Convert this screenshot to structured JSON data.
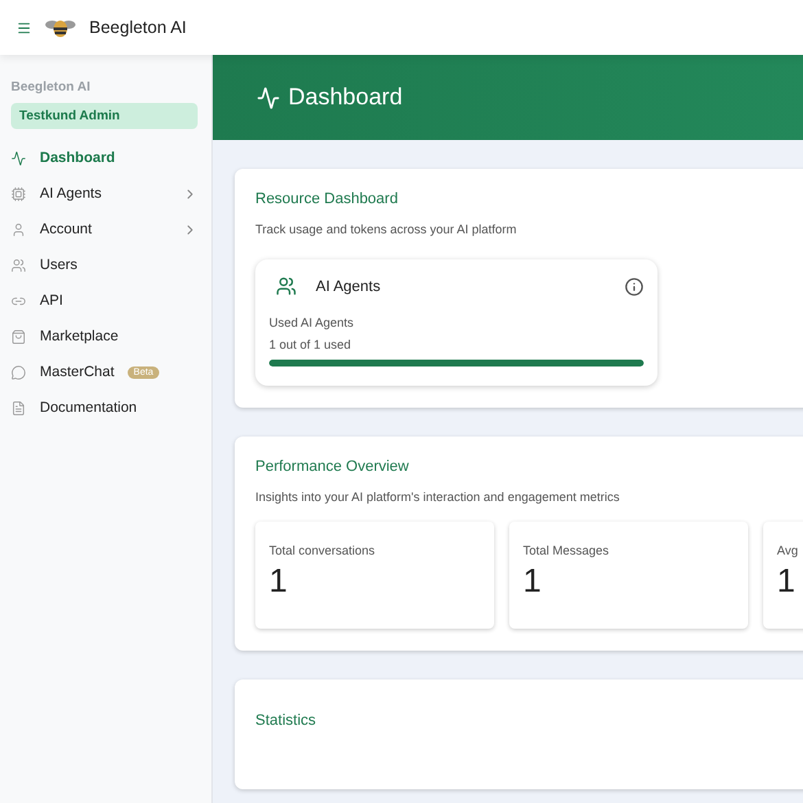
{
  "app": {
    "name": "Beegleton AI"
  },
  "sidebar": {
    "org": "Beegleton AI",
    "account": "Testkund Admin",
    "items": [
      {
        "label": "Dashboard",
        "selected": true,
        "submenu": false
      },
      {
        "label": "AI Agents",
        "selected": false,
        "submenu": true
      },
      {
        "label": "Account",
        "selected": false,
        "submenu": true
      },
      {
        "label": "Users",
        "selected": false,
        "submenu": false
      },
      {
        "label": "API",
        "selected": false,
        "submenu": false
      },
      {
        "label": "Marketplace",
        "selected": false,
        "submenu": false
      },
      {
        "label": "MasterChat",
        "selected": false,
        "submenu": false,
        "badge": "Beta"
      },
      {
        "label": "Documentation",
        "selected": false,
        "submenu": false
      }
    ]
  },
  "header": {
    "title": "Dashboard"
  },
  "resource": {
    "title": "Resource Dashboard",
    "subtitle": "Track usage and tokens across your AI platform",
    "cards": [
      {
        "title": "AI Agents",
        "label": "Used AI Agents",
        "usage": "1 out of 1 used",
        "level": 1
      }
    ]
  },
  "performance": {
    "title": "Performance Overview",
    "subtitle": "Insights into your AI platform's interaction and engagement metrics",
    "metrics": [
      {
        "label": "Total conversations",
        "value": "1"
      },
      {
        "label": "Total Messages",
        "value": "1"
      },
      {
        "label": "Avg",
        "value": "1"
      }
    ]
  },
  "statistics": {
    "title": "Statistics"
  }
}
